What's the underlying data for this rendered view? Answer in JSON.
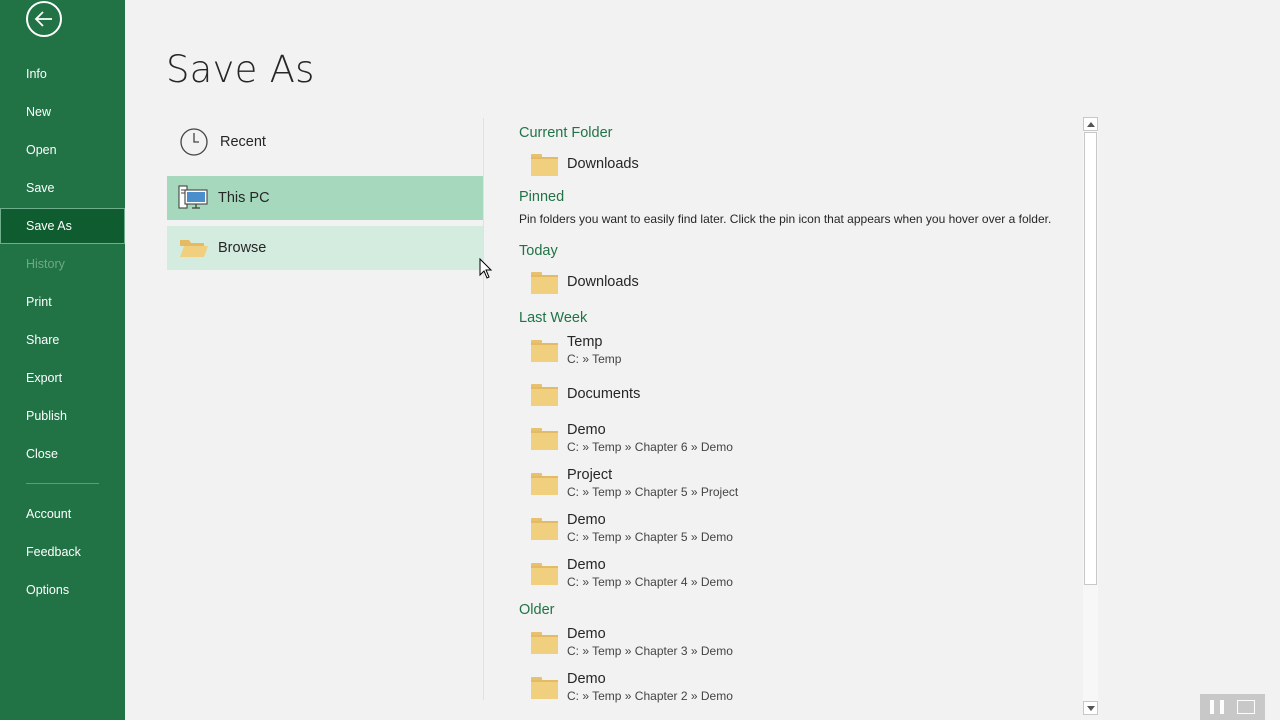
{
  "sidebar": {
    "back_icon": "arrow-left-icon",
    "items": [
      {
        "label": "Info"
      },
      {
        "label": "New"
      },
      {
        "label": "Open"
      },
      {
        "label": "Save"
      },
      {
        "label": "Save As"
      },
      {
        "label": "History"
      },
      {
        "label": "Print"
      },
      {
        "label": "Share"
      },
      {
        "label": "Export"
      },
      {
        "label": "Publish"
      },
      {
        "label": "Close"
      },
      {
        "label": "Account"
      },
      {
        "label": "Feedback"
      },
      {
        "label": "Options"
      }
    ],
    "active": "Save As",
    "disabled": [
      "History"
    ]
  },
  "page": {
    "title": "Save As"
  },
  "locations": [
    {
      "label": "Recent",
      "icon": "clock-icon"
    },
    {
      "label": "This PC",
      "icon": "computer-icon"
    },
    {
      "label": "Browse",
      "icon": "folder-open-icon"
    }
  ],
  "sections": {
    "current_folder": {
      "heading": "Current Folder",
      "folders": [
        {
          "name": "Downloads",
          "path": ""
        }
      ]
    },
    "pinned": {
      "heading": "Pinned",
      "description": "Pin folders you want to easily find later. Click the pin icon that appears when you hover over a folder."
    },
    "today": {
      "heading": "Today",
      "folders": [
        {
          "name": "Downloads",
          "path": ""
        }
      ]
    },
    "last_week": {
      "heading": "Last Week",
      "folders": [
        {
          "name": "Temp",
          "path": "C: » Temp"
        },
        {
          "name": "Documents",
          "path": ""
        },
        {
          "name": "Demo",
          "path": "C: » Temp » Chapter 6 » Demo"
        },
        {
          "name": "Project",
          "path": "C: » Temp » Chapter 5 » Project"
        },
        {
          "name": "Demo",
          "path": "C: » Temp » Chapter 5 » Demo"
        },
        {
          "name": "Demo",
          "path": "C: » Temp » Chapter 4 » Demo"
        }
      ]
    },
    "older": {
      "heading": "Older",
      "folders": [
        {
          "name": "Demo",
          "path": "C: » Temp » Chapter 3 » Demo"
        },
        {
          "name": "Demo",
          "path": "C: » Temp » Chapter 2 » Demo"
        }
      ]
    }
  },
  "colors": {
    "brand": "#217346",
    "selected_location": "#a6d8bd",
    "hover_location": "#d3ecdf",
    "folder": "#f0cf7e"
  }
}
